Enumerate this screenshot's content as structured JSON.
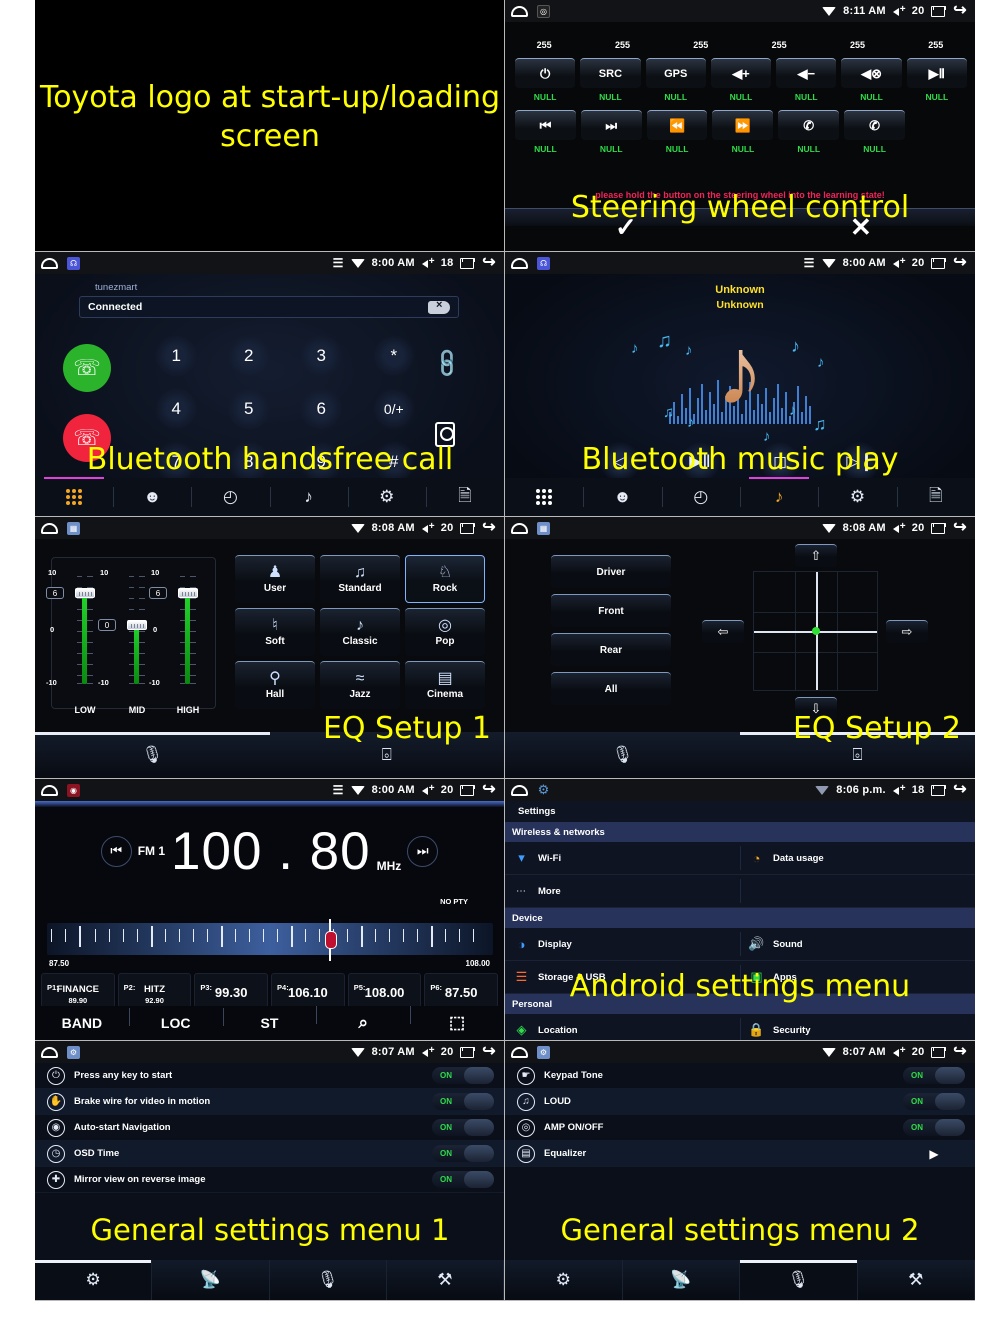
{
  "panels": {
    "toyota": {
      "caption": "Toyota logo at\nstart-up/loading screen"
    },
    "steering": {
      "caption": "Steering wheel control",
      "status": {
        "time": "8:11 AM",
        "volume": "20"
      },
      "values": [
        "255",
        "255",
        "255",
        "255",
        "255",
        "255"
      ],
      "row1_icons": [
        "power-icon",
        "src-icon",
        "gps-icon",
        "volume-up-icon",
        "volume-down-icon",
        "mute-icon",
        "play-pause-icon"
      ],
      "row1_glyphs": [
        "⏻",
        "SRC",
        "GPS",
        "◀+",
        "◀−",
        "◀⊗",
        "▶Ⅱ"
      ],
      "row1_labels": [
        "NULL",
        "NULL",
        "NULL",
        "NULL",
        "NULL",
        "NULL",
        "NULL"
      ],
      "row2_icons": [
        "prev-track-icon",
        "next-track-icon",
        "rewind-icon",
        "fast-forward-icon",
        "call-answer-icon",
        "call-end-icon"
      ],
      "row2_glyphs": [
        "⏮",
        "⏭",
        "⏪",
        "⏩",
        "✆",
        "✆"
      ],
      "row2_labels": [
        "NULL",
        "NULL",
        "NULL",
        "NULL",
        "NULL",
        "NULL"
      ],
      "hint": "please hold the button on the steering wheel into the learning state!",
      "confirm": "✓",
      "cancel": "✕"
    },
    "bt_call": {
      "caption": "Bluetooth handsfree call",
      "status": {
        "time": "8:00 AM",
        "volume": "18"
      },
      "device_name": "tunezmart",
      "input_value": "Connected",
      "keys": [
        "1",
        "2",
        "3",
        "*",
        "4",
        "5",
        "6",
        "0/+",
        "7",
        "8",
        "9",
        "#"
      ],
      "tabs": [
        "keypad-icon",
        "contacts-icon",
        "history-icon",
        "music-icon",
        "settings-icon",
        "log-icon"
      ],
      "active_tab": 0
    },
    "bt_music": {
      "caption": "Bluetooth music play",
      "status": {
        "time": "8:00 AM",
        "volume": "20"
      },
      "track_title": "Unknown",
      "track_artist": "Unknown",
      "controls": [
        "◁",
        "▶Ⅱ",
        "◻",
        "▷❙"
      ],
      "control_names": [
        "previous-button",
        "play-pause-button",
        "stop-button",
        "next-button"
      ],
      "tabs": [
        "keypad-icon",
        "contacts-icon",
        "history-icon",
        "music-icon",
        "settings-icon",
        "log-icon"
      ],
      "active_tab": 3
    },
    "eq1": {
      "caption": "EQ Setup 1",
      "status": {
        "time": "8:08 AM",
        "volume": "20"
      },
      "scale": {
        "top": "10",
        "mid": "0",
        "bottom": "-10"
      },
      "bands": [
        {
          "name": "LOW",
          "value": "6"
        },
        {
          "name": "MID",
          "value": "0"
        },
        {
          "name": "HIGH",
          "value": "6"
        }
      ],
      "presets": [
        {
          "label": "User",
          "glyph": "⛭"
        },
        {
          "label": "Standard",
          "glyph": "♫"
        },
        {
          "label": "Rock",
          "glyph": "⚰"
        },
        {
          "label": "Soft",
          "glyph": "⬒"
        },
        {
          "label": "Classic",
          "glyph": "☄"
        },
        {
          "label": "Pop",
          "glyph": "◎"
        },
        {
          "label": "Hall",
          "glyph": "⚘"
        },
        {
          "label": "Jazz",
          "glyph": "≀"
        },
        {
          "label": "Cinema",
          "glyph": "▤"
        }
      ],
      "selected_preset": "Rock",
      "tabs": [
        "equalizer-icon",
        "balance-icon"
      ],
      "active_tab": 0
    },
    "eq2": {
      "caption": "EQ Setup 2",
      "status": {
        "time": "8:08 AM",
        "volume": "20"
      },
      "zones": [
        "Driver",
        "Front",
        "Rear",
        "All"
      ],
      "arrows": {
        "up": "⇧",
        "down": "⇩",
        "left": "⇦",
        "right": "⇨"
      },
      "tabs": [
        "equalizer-icon",
        "balance-icon"
      ],
      "active_tab": 1
    },
    "radio": {
      "status": {
        "time": "8:00 AM",
        "volume": "20"
      },
      "band": "FM 1",
      "frequency": "100 . 80",
      "unit": "MHz",
      "pty": "NO PTY",
      "scale_min": "87.50",
      "scale_max": "108.00",
      "presets": [
        {
          "num": "P1:",
          "name": "FINANCE",
          "freq": "89.90"
        },
        {
          "num": "P2:",
          "name": "HITZ",
          "freq": "92.90"
        },
        {
          "num": "P3:",
          "name": "99.30",
          "freq": ""
        },
        {
          "num": "P4:",
          "name": "106.10",
          "freq": ""
        },
        {
          "num": "P5:",
          "name": "108.00",
          "freq": ""
        },
        {
          "num": "P6:",
          "name": "87.50",
          "freq": ""
        }
      ],
      "buttons": [
        "BAND",
        "LOC",
        "ST",
        "⌕",
        "⬚"
      ]
    },
    "android_settings": {
      "caption": "Android settings menu",
      "status": {
        "time": "8:06 p.m.",
        "volume": "18"
      },
      "title": "Settings",
      "sections": [
        {
          "header": "Wireless & networks",
          "rows": [
            [
              {
                "label": "Wi-Fi",
                "icon": "wifi-icon",
                "glyph": "▼",
                "color": "#3f9bff"
              },
              {
                "label": "Data usage",
                "icon": "data-usage-icon",
                "glyph": "◔",
                "color": "#f5a623"
              }
            ],
            [
              {
                "label": "More",
                "icon": "more-icon",
                "glyph": "•••",
                "color": "#ffffff"
              },
              {
                "label": "",
                "icon": "",
                "glyph": "",
                "color": ""
              }
            ]
          ]
        },
        {
          "header": "Device",
          "rows": [
            [
              {
                "label": "Display",
                "icon": "display-icon",
                "glyph": "◑",
                "color": "#3f9bff"
              },
              {
                "label": "Sound",
                "icon": "sound-icon",
                "glyph": "ᵔ",
                "color": "#9b6bff"
              }
            ],
            [
              {
                "label": "Storage & USB",
                "icon": "storage-icon",
                "glyph": "≡",
                "color": "#ff6a2a"
              },
              {
                "label": "Apps",
                "icon": "apps-icon",
                "glyph": "▣",
                "color": "#2fdc4a"
              }
            ]
          ]
        },
        {
          "header": "Personal",
          "rows": [
            [
              {
                "label": "Location",
                "icon": "location-icon",
                "glyph": "◈",
                "color": "#2fdc4a"
              },
              {
                "label": "Security",
                "icon": "security-icon",
                "glyph": "ὑ2",
                "color": "#ff8c1a"
              }
            ]
          ]
        }
      ]
    },
    "general1": {
      "caption": "General settings menu 1",
      "status": {
        "time": "8:07 AM",
        "volume": "20"
      },
      "rows": [
        {
          "label": "Press any key to start",
          "icon": "power-icon",
          "glyph": "⏻",
          "state": "ON"
        },
        {
          "label": "Brake wire for video in motion",
          "icon": "brake-icon",
          "glyph": "✈",
          "state": "ON"
        },
        {
          "label": "Auto-start Navigation",
          "icon": "navigation-icon",
          "glyph": "◉",
          "state": "ON"
        },
        {
          "label": "OSD Time",
          "icon": "clock-icon",
          "glyph": "◔",
          "state": "ON"
        },
        {
          "label": "Mirror view on reverse image",
          "icon": "mirror-icon",
          "glyph": "⊕",
          "state": "ON"
        }
      ],
      "tabs": [
        "settings-icon",
        "radio-icon",
        "equalizer-icon",
        "tools-icon"
      ],
      "active_tab": 0
    },
    "general2": {
      "caption": "General settings menu 2",
      "status": {
        "time": "8:07 AM",
        "volume": "20"
      },
      "rows": [
        {
          "label": "Keypad Tone",
          "icon": "touch-icon",
          "glyph": "☝",
          "state": "ON"
        },
        {
          "label": "LOUD",
          "icon": "loud-icon",
          "glyph": "☗",
          "state": "ON"
        },
        {
          "label": "AMP ON/OFF",
          "icon": "amp-icon",
          "glyph": "◎",
          "state": "ON"
        },
        {
          "label": "Equalizer",
          "icon": "equalizer-icon",
          "glyph": "⚙",
          "state": "▶"
        }
      ],
      "tabs": [
        "settings-icon",
        "radio-icon",
        "equalizer-icon",
        "tools-icon"
      ],
      "active_tab": 2
    }
  },
  "colors": {
    "caption_yellow": "#ffff00",
    "hint_red": "#f0245a",
    "null_green": "#2fdc4a",
    "accent_blue": "#7fb3ff",
    "slider_green": "#21d62b"
  }
}
